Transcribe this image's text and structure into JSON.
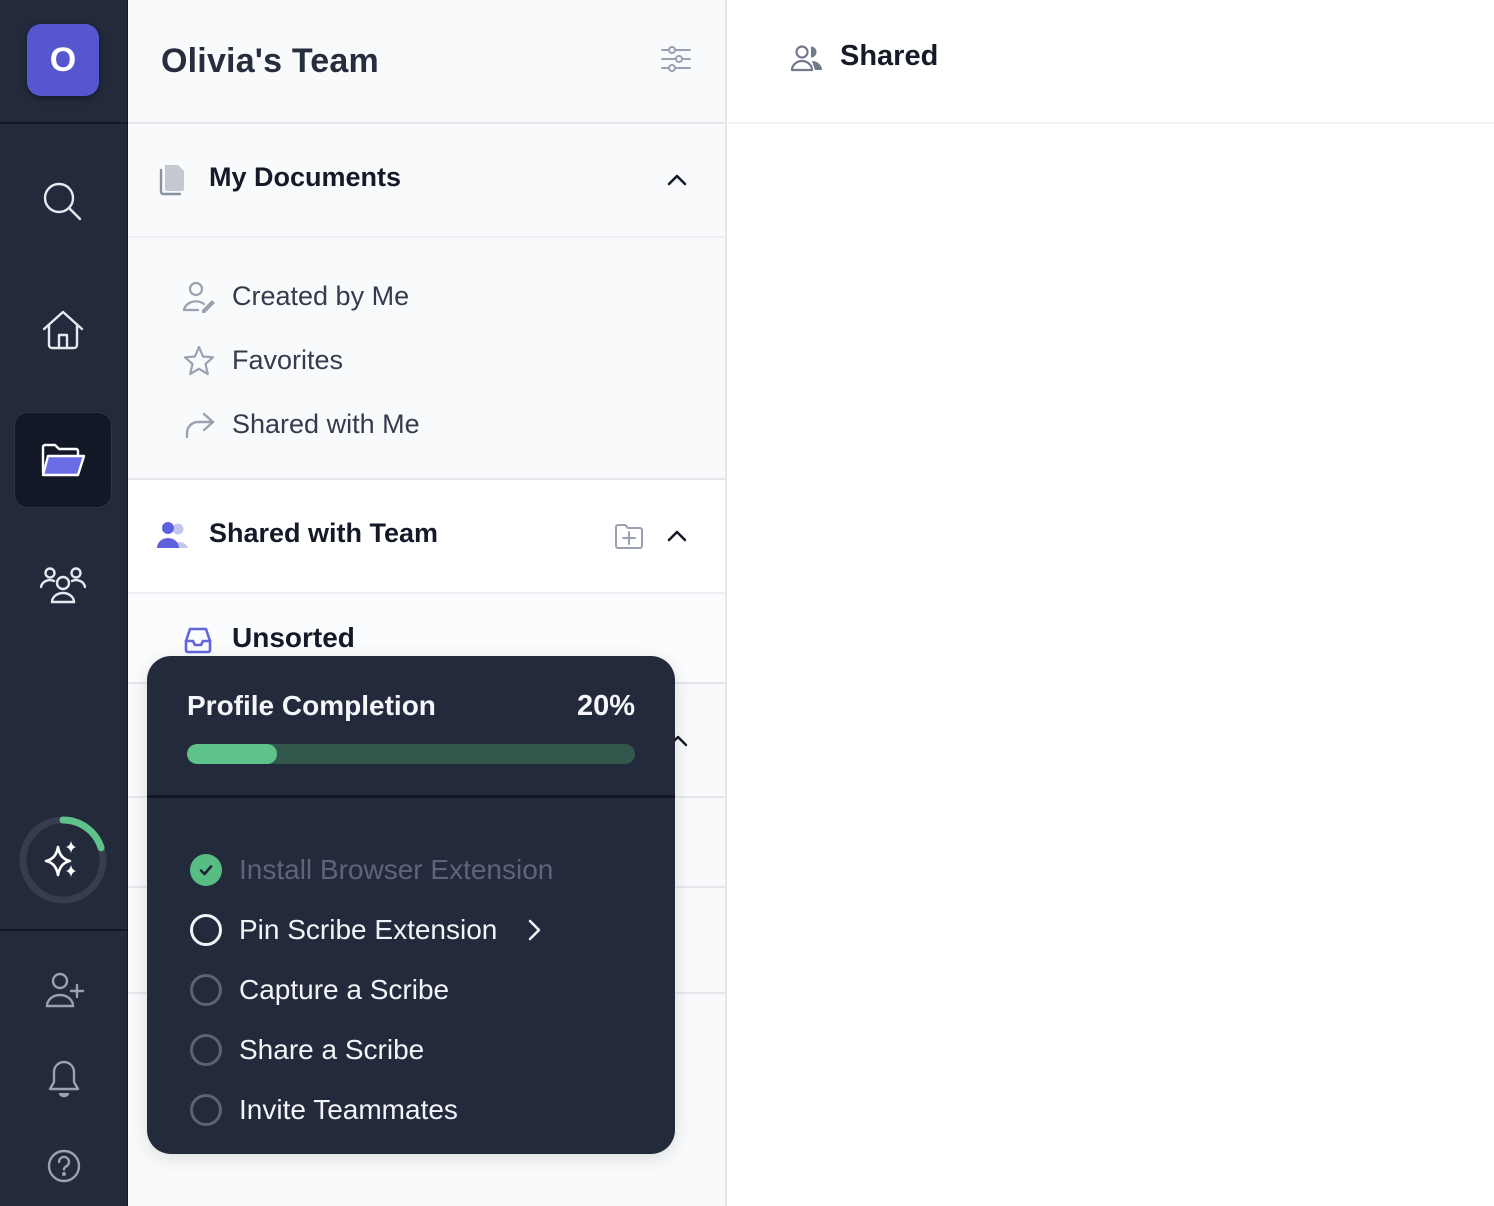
{
  "rail": {
    "avatar_letter": "O",
    "icons": [
      "search-icon",
      "home-icon",
      "folder-open-icon",
      "team-icon",
      "sparkles-icon",
      "add-user-icon",
      "bell-icon",
      "help-icon"
    ],
    "active": "folder-open-icon",
    "profile_progress": 0.2
  },
  "sidebar": {
    "team_name": "Olivia's Team",
    "my_documents": {
      "title": "My Documents",
      "items": [
        {
          "label": "Created by Me",
          "icon": "user-edit-icon"
        },
        {
          "label": "Favorites",
          "icon": "star-icon"
        },
        {
          "label": "Shared with Me",
          "icon": "share-arrow-icon"
        }
      ]
    },
    "shared_with_team": {
      "title": "Shared with Team",
      "items": [
        {
          "label": "Unsorted",
          "icon": "inbox-icon"
        }
      ]
    }
  },
  "main": {
    "title": "Shared"
  },
  "profile_completion": {
    "title": "Profile Completion",
    "percent_label": "20%",
    "percent": 20,
    "steps": [
      {
        "label": "Install Browser Extension",
        "status": "done"
      },
      {
        "label": "Pin Scribe Extension",
        "status": "current"
      },
      {
        "label": "Capture a Scribe",
        "status": "todo"
      },
      {
        "label": "Share a Scribe",
        "status": "todo"
      },
      {
        "label": "Invite Teammates",
        "status": "todo"
      }
    ]
  },
  "colors": {
    "accent": "#5657cf",
    "rail_bg": "#222a3b",
    "progress": "#5ec28a",
    "progress_track": "#32584e"
  }
}
